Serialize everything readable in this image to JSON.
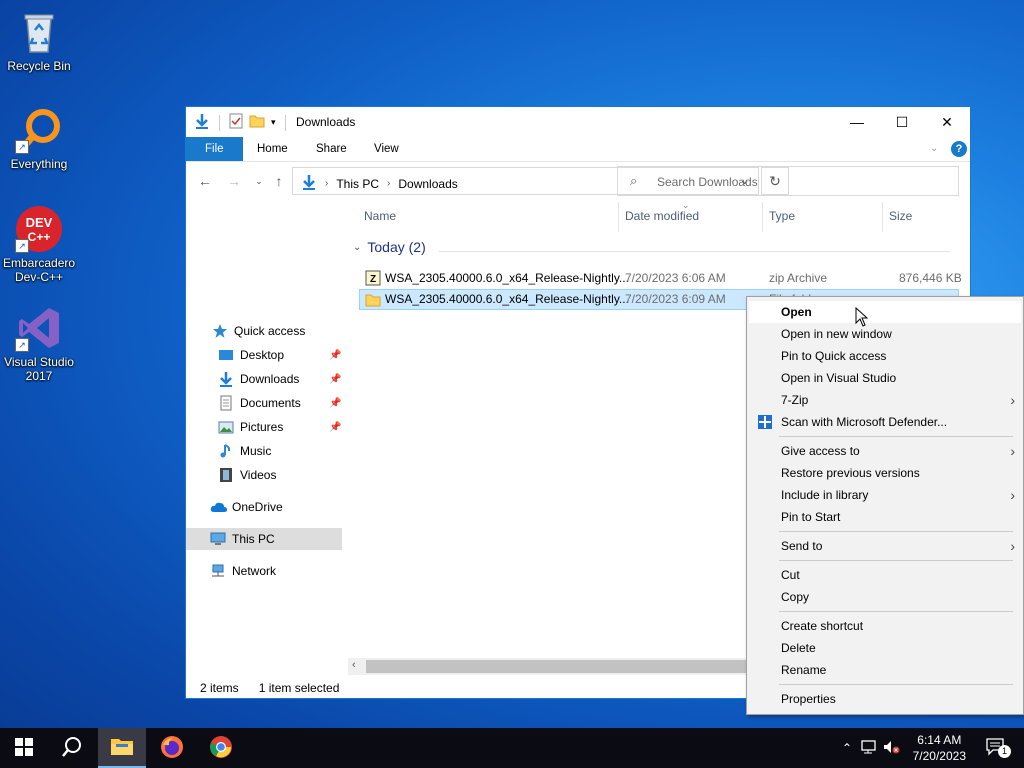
{
  "desktop": {
    "icons": [
      {
        "label": "Recycle Bin"
      },
      {
        "label": "Everything"
      },
      {
        "label": "Embarcadero Dev-C++"
      },
      {
        "label": "Visual Studio 2017"
      }
    ]
  },
  "window": {
    "title": "Downloads",
    "controls": {
      "minimize": "—",
      "maximize": "☐",
      "close": "✕"
    },
    "ribbon_tabs": [
      "File",
      "Home",
      "Share",
      "View"
    ],
    "address": {
      "crumbs": [
        "This PC",
        "Downloads"
      ]
    },
    "search": {
      "placeholder": "Search Downloads"
    },
    "nav": {
      "quick_access": "Quick access",
      "items": [
        "Desktop",
        "Downloads",
        "Documents",
        "Pictures",
        "Music",
        "Videos"
      ],
      "onedrive": "OneDrive",
      "this_pc": "This PC",
      "network": "Network"
    },
    "columns": [
      "Name",
      "Date modified",
      "Type",
      "Size"
    ],
    "group": "Today (2)",
    "files": [
      {
        "name": "WSA_2305.40000.6.0_x64_Release-Nightly...",
        "date": "7/20/2023 6:06 AM",
        "type": "zip Archive",
        "size": "876,446 KB"
      },
      {
        "name": "WSA_2305.40000.6.0_x64_Release-Nightly...",
        "date": "7/20/2023 6:09 AM",
        "type": "File folder",
        "size": ""
      }
    ],
    "status": {
      "items": "2 items",
      "selected": "1 item selected"
    }
  },
  "context_menu": {
    "items": [
      "Open",
      "Open in new window",
      "Pin to Quick access",
      "Open in Visual Studio",
      "7-Zip",
      "Scan with Microsoft Defender...",
      "Give access to",
      "Restore previous versions",
      "Include in library",
      "Pin to Start",
      "Send to",
      "Cut",
      "Copy",
      "Create shortcut",
      "Delete",
      "Rename",
      "Properties"
    ]
  },
  "taskbar": {
    "time": "6:14 AM",
    "date": "7/20/2023",
    "notification_count": "1"
  },
  "colors": {
    "accent": "#1979ca",
    "selection": "#cce8ff",
    "taskbar": "#0b0b14"
  }
}
